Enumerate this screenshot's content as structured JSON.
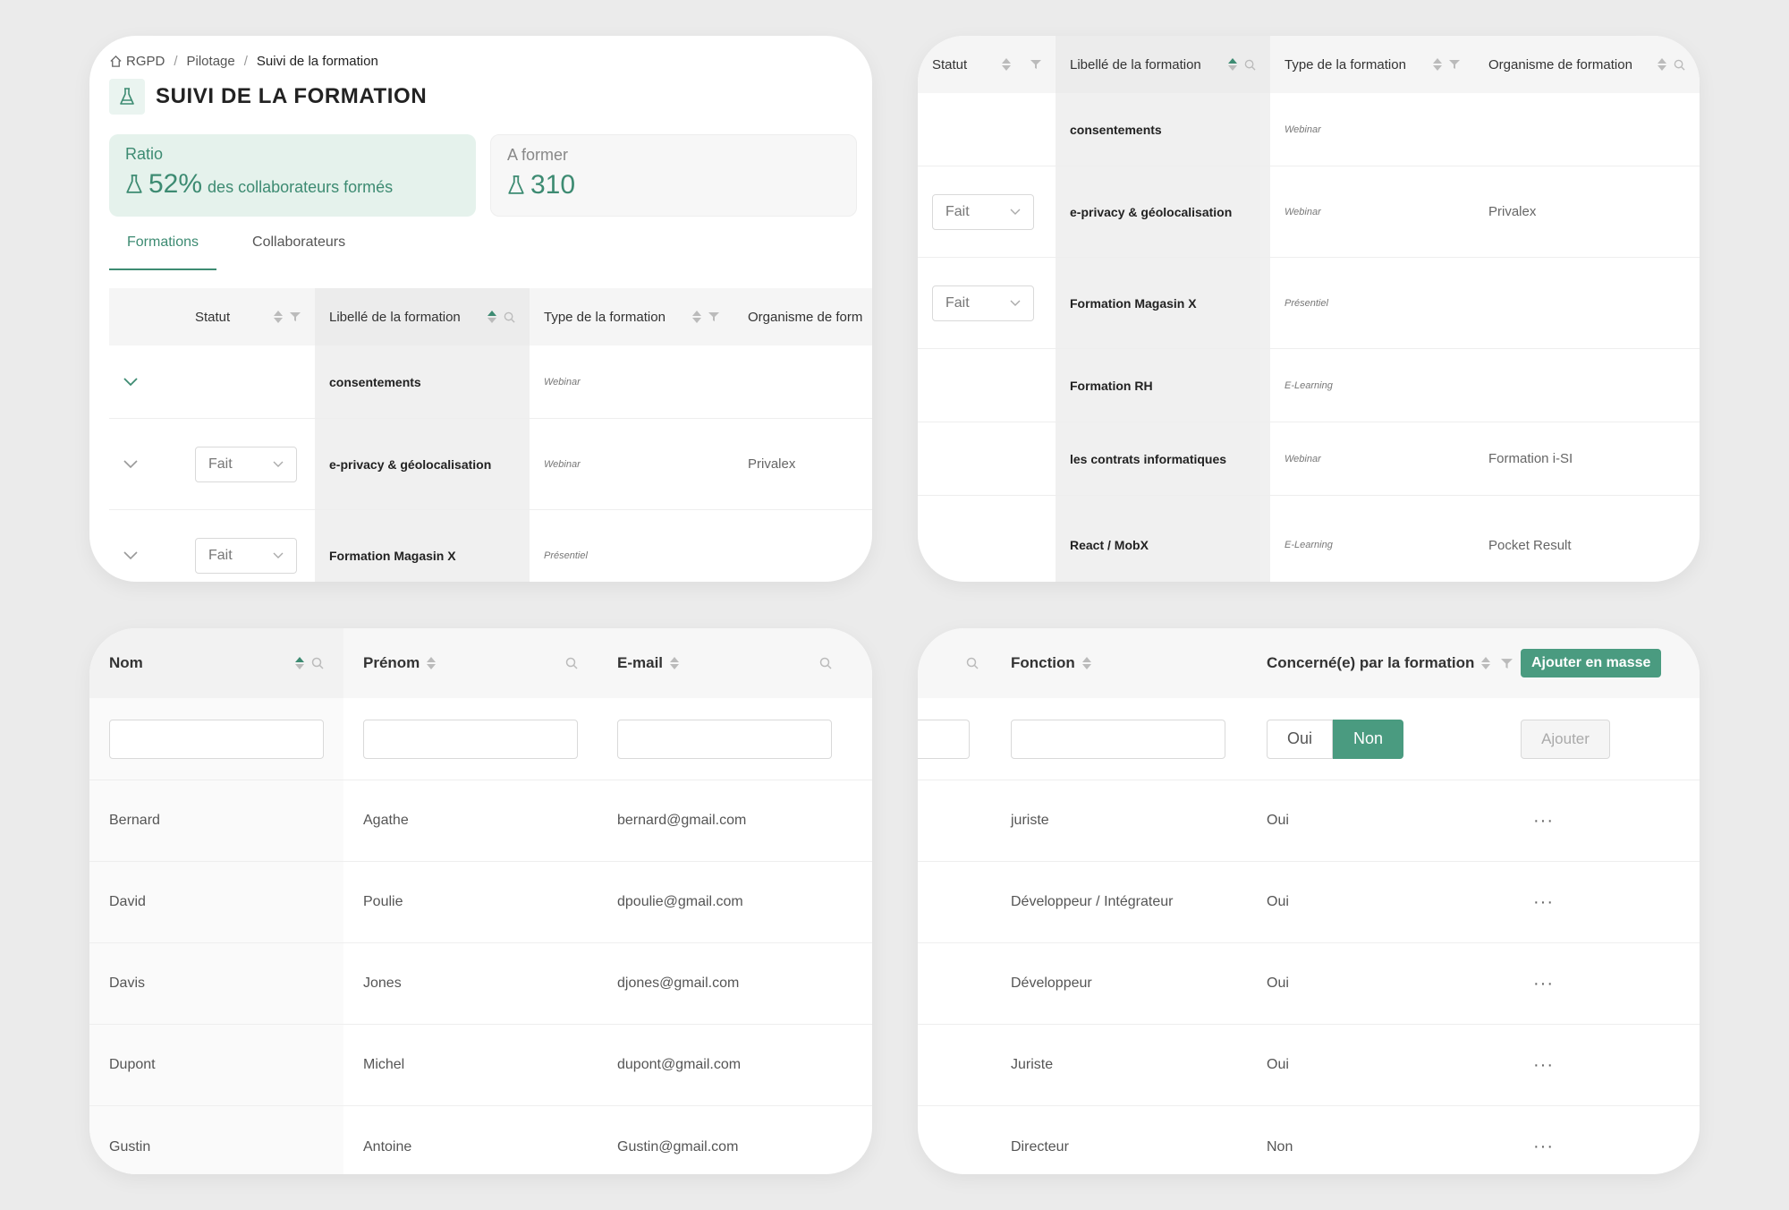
{
  "breadcrumb": [
    "RGPD",
    "Pilotage",
    "Suivi de la formation"
  ],
  "page_title": "SUIVI DE LA FORMATION",
  "stats": {
    "ratio": {
      "label": "Ratio",
      "value": "52%",
      "suffix": "des collaborateurs formés"
    },
    "a_former": {
      "label": "A former",
      "value": "310"
    }
  },
  "tabs": [
    "Formations",
    "Collaborateurs"
  ],
  "formations": {
    "headers": {
      "statut": "Statut",
      "libelle": "Libellé de la formation",
      "type": "Type de la formation",
      "organisme_truncated": "Organisme de form",
      "organisme": "Organisme de formation"
    },
    "rows": [
      {
        "statut": "",
        "libelle": "consentements",
        "type": "Webinar",
        "organisme": ""
      },
      {
        "statut": "Fait",
        "libelle": "e-privacy & géolocalisation",
        "type": "Webinar",
        "organisme": "Privalex"
      },
      {
        "statut": "Fait",
        "libelle": "Formation Magasin X",
        "type": "Présentiel",
        "organisme": ""
      },
      {
        "statut": "",
        "libelle": "Formation RH",
        "type": "E-Learning",
        "organisme": ""
      },
      {
        "statut": "",
        "libelle": "les contrats informatiques",
        "type": "Webinar",
        "organisme": "Formation i-SI"
      },
      {
        "statut": "",
        "libelle": "React / MobX",
        "type": "E-Learning",
        "organisme": "Pocket Result"
      }
    ]
  },
  "collaborateurs": {
    "headers": {
      "nom": "Nom",
      "prenom": "Prénom",
      "email": "E-mail",
      "fonction": "Fonction",
      "concerne": "Concerné(e) par la formation"
    },
    "toggle": {
      "oui": "Oui",
      "non": "Non",
      "selected": "Non"
    },
    "ajouter_masse": "Ajouter en masse",
    "ajouter": "Ajouter",
    "actions_label": "···",
    "rows": [
      {
        "nom": "Bernard",
        "prenom": "Agathe",
        "email": "bernard@gmail.com",
        "fonction": "juriste",
        "concerne": "Oui"
      },
      {
        "nom": "David",
        "prenom": "Poulie",
        "email": "dpoulie@gmail.com",
        "fonction": "Développeur / Intégrateur",
        "concerne": "Oui"
      },
      {
        "nom": "Davis",
        "prenom": "Jones",
        "email": "djones@gmail.com",
        "fonction": "Développeur",
        "concerne": "Oui"
      },
      {
        "nom": "Dupont",
        "prenom": "Michel",
        "email": "dupont@gmail.com",
        "fonction": "Juriste",
        "concerne": "Oui"
      },
      {
        "nom": "Gustin",
        "prenom": "Antoine",
        "email": "Gustin@gmail.com",
        "fonction": "Directeur",
        "concerne": "Non"
      }
    ]
  },
  "colors": {
    "accent": "#3d8b72",
    "accent_button": "#4a9b80",
    "ratio_background": "#e5f2ec",
    "page_background": "#ebebeb"
  },
  "icons": {
    "home": "home-icon",
    "flask": "flask-icon",
    "chevron": "chevron-down-icon",
    "sort": "sort-icon",
    "filter": "filter-icon",
    "search": "search-icon"
  }
}
